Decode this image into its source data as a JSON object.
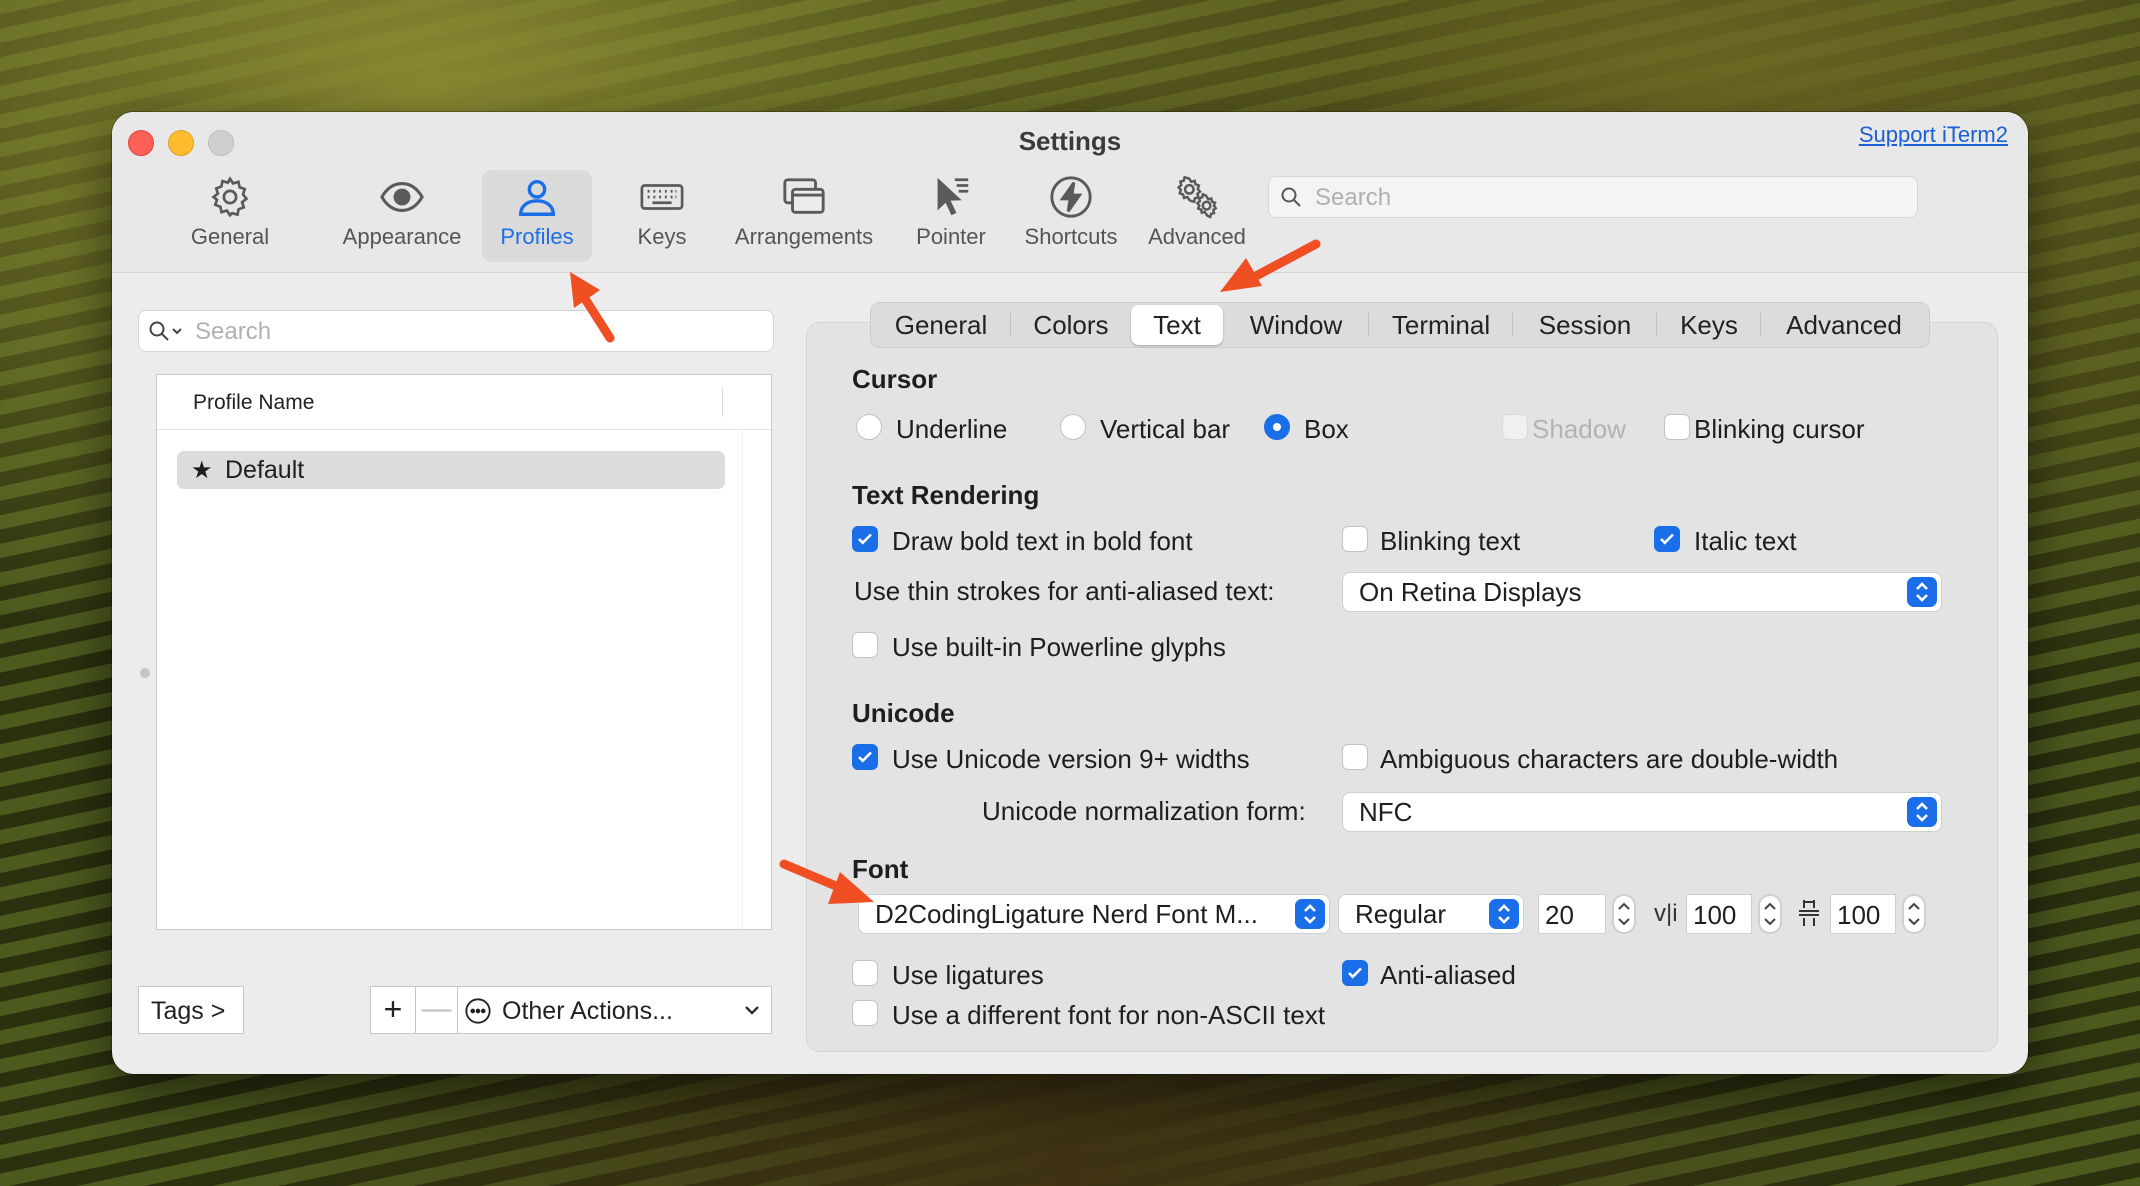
{
  "window": {
    "title": "Settings",
    "support_link": "Support iTerm2"
  },
  "toolbar": {
    "items": [
      {
        "label": "General",
        "icon": "gear-icon"
      },
      {
        "label": "Appearance",
        "icon": "eye-icon"
      },
      {
        "label": "Profiles",
        "icon": "person-icon",
        "active": true
      },
      {
        "label": "Keys",
        "icon": "keyboard-icon"
      },
      {
        "label": "Arrangements",
        "icon": "windows-icon"
      },
      {
        "label": "Pointer",
        "icon": "pointer-icon"
      },
      {
        "label": "Shortcuts",
        "icon": "bolt-icon"
      },
      {
        "label": "Advanced",
        "icon": "gears-icon"
      }
    ],
    "search_placeholder": "Search"
  },
  "profiles": {
    "search_placeholder": "Search",
    "column_header": "Profile Name",
    "items": [
      {
        "name": "Default",
        "star": "★"
      }
    ],
    "tags_button": "Tags >",
    "add_symbol": "+",
    "remove_symbol": "—",
    "other_actions": "Other Actions..."
  },
  "tabs": [
    "General",
    "Colors",
    "Text",
    "Window",
    "Terminal",
    "Session",
    "Keys",
    "Advanced"
  ],
  "active_tab": "Text",
  "cursor": {
    "title": "Cursor",
    "options": [
      "Underline",
      "Vertical bar",
      "Box"
    ],
    "selected": "Box",
    "shadow": "Shadow",
    "blinking": "Blinking cursor"
  },
  "text_rendering": {
    "title": "Text Rendering",
    "bold": "Draw bold text in bold font",
    "blinking_text": "Blinking text",
    "italic": "Italic text",
    "thin_strokes_label": "Use thin strokes for anti-aliased text:",
    "thin_strokes_value": "On Retina Displays",
    "powerline": "Use built-in Powerline glyphs"
  },
  "unicode": {
    "title": "Unicode",
    "widths": "Use Unicode version 9+ widths",
    "ambiguous": "Ambiguous characters are double-width",
    "normalization_label": "Unicode normalization form:",
    "normalization_value": "NFC"
  },
  "font": {
    "title": "Font",
    "family": "D2CodingLigature Nerd Font M...",
    "style": "Regular",
    "size": "20",
    "h_spacing": "100",
    "v_spacing": "100",
    "ligatures": "Use ligatures",
    "anti_aliased": "Anti-aliased",
    "non_ascii": "Use a different font for non-ASCII text"
  },
  "colors": {
    "accent": "#1a6ee8",
    "annotation_arrow": "#f04e23"
  }
}
